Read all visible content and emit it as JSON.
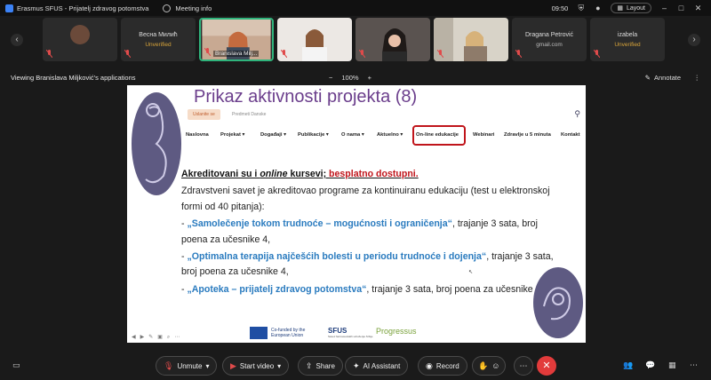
{
  "window": {
    "title": "Erasmus SFUS - Prijatelj zdravog potomstva",
    "meeting_info": "Meeting info",
    "time": "09:50",
    "layout_label": "Layout"
  },
  "participants": [
    {
      "name": "",
      "sub": ""
    },
    {
      "name": "Весна Милић",
      "sub": "Unverified"
    },
    {
      "name": "Branislava Milj...",
      "sub": ""
    },
    {
      "name": "",
      "sub": ""
    },
    {
      "name": "",
      "sub": ""
    },
    {
      "name": "",
      "sub": ""
    },
    {
      "name": "Dragana Petrović",
      "sub": "gmail.com"
    },
    {
      "name": "izabela",
      "sub": "Unverified"
    }
  ],
  "view_bar": {
    "viewing": "Viewing Branislava Miljković's applications",
    "zoom": "100%",
    "minus": "−",
    "plus": "+",
    "annotate": "Annotate",
    "more": "⋮"
  },
  "slide": {
    "title": "Prikaz aktivnosti projekta (8)",
    "site_button": "Uslanite se",
    "site_button_label": "Predmeti Danske",
    "menu": [
      "Naslovna",
      "Projekat ▾",
      "Događaji ▾",
      "Publikacije ▾",
      "O nama ▾",
      "Aktuelno ▾",
      "On-line edukacije",
      "Webinari",
      "Zdravlje u 5 minuta",
      "Kontakt"
    ],
    "heading_prefix": "Akreditovani su i ",
    "heading_online": "online",
    "heading_mid": " kursevi; ",
    "heading_red": "besplatno dostupni.",
    "intro": "Zdravstveni savet je akreditovao programe za kontinuiranu edukaciju (test u elektronskoj formi od 40 pitanja):",
    "courses": [
      {
        "prefix": "- ",
        "name": "„Samolečenje tokom trudnoće – mogućnosti i ograničenja“",
        "rest": ", trajanje 3 sata, broj poena za učesnike 4,"
      },
      {
        "prefix": "- ",
        "name": "„Optimalna terapija najčešćih bolesti u periodu trudnoće i dojenja“",
        "rest": ", trajanje 3 sata, broj poena za učesnike 4,"
      },
      {
        "prefix": "- ",
        "name": "„Apoteka – prijatelj zdravog potomstva“",
        "rest": ", trajanje 3 sata, broj poena za učesnike 4"
      }
    ],
    "logos": {
      "eu_text": "Co-funded by the European Union",
      "sfus": "SFUS",
      "sfus_sub": "Savez farmaceutskih udruženja Srbije",
      "progressus": "Progressus"
    }
  },
  "controls": {
    "unmute": "Unmute",
    "start_video": "Start video",
    "share": "Share",
    "ai_assistant": "AI Assistant",
    "record": "Record"
  },
  "colors": {
    "accent_green": "#2fb47c",
    "leave_red": "#e23b3b",
    "slide_title": "#6b3e8c",
    "course_blue": "#2a7bbf",
    "highlight_red": "#c0151b"
  }
}
